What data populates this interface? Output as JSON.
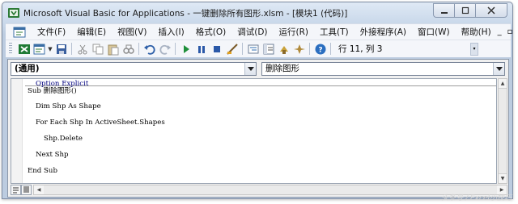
{
  "window": {
    "title": "Microsoft Visual Basic for Applications - 一键删除所有图形.xlsm - [模块1 (代码)]"
  },
  "menu": {
    "items": [
      {
        "label": "文件(F)"
      },
      {
        "label": "编辑(E)"
      },
      {
        "label": "视图(V)"
      },
      {
        "label": "插入(I)"
      },
      {
        "label": "格式(O)"
      },
      {
        "label": "调试(D)"
      },
      {
        "label": "运行(R)"
      },
      {
        "label": "工具(T)"
      },
      {
        "label": "外接程序(A)"
      },
      {
        "label": "窗口(W)"
      },
      {
        "label": "帮助(H)"
      }
    ]
  },
  "toolbar": {
    "icons": [
      "excel-view-icon",
      "insert-module-icon",
      "save-icon",
      "cut-icon",
      "copy-icon",
      "paste-icon",
      "find-icon",
      "undo-icon",
      "redo-icon",
      "run-icon",
      "break-icon",
      "reset-icon",
      "design-mode-icon",
      "project-explorer-icon",
      "properties-icon",
      "object-browser-icon",
      "toolbox-icon",
      "help-icon"
    ],
    "cursor_position": "行 11, 列 3"
  },
  "code_window": {
    "object_combo": "(通用)",
    "procedure_combo": "删除图形",
    "lines": {
      "option": "Option Explicit",
      "sub": "Sub 删除图形()",
      "dim": "Dim Shp As Shape",
      "for": "For Each Shp In ActiveSheet.Shapes",
      "delete": "Shp.Delete",
      "next": "Next Shp",
      "end": "End Sub"
    }
  },
  "watermark": "头条号 / Excel小技巧"
}
